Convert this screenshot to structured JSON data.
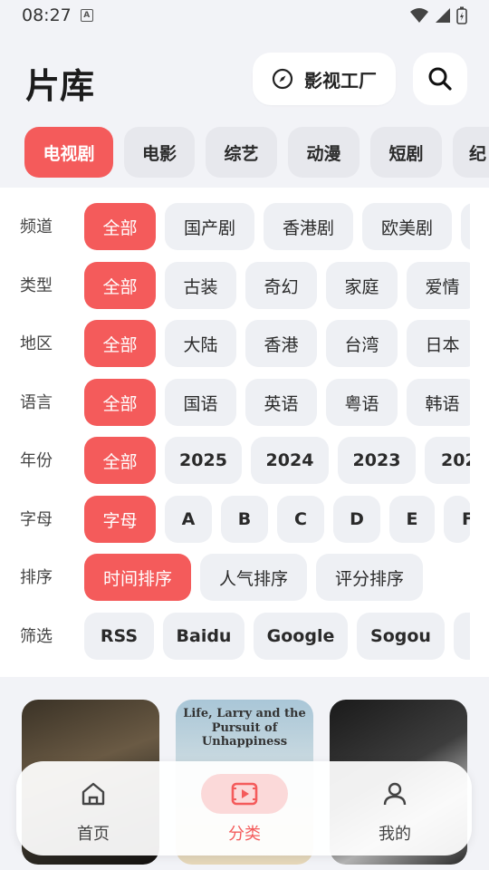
{
  "status_bar": {
    "time": "08:27",
    "notification_icon": "a-icon"
  },
  "header": {
    "title": "片库",
    "studio_label": "影视工厂",
    "studio_icon": "compass-icon",
    "search_icon": "search-icon"
  },
  "categories": [
    {
      "label": "电视剧",
      "active": true
    },
    {
      "label": "电影",
      "active": false
    },
    {
      "label": "综艺",
      "active": false
    },
    {
      "label": "动漫",
      "active": false
    },
    {
      "label": "短剧",
      "active": false
    },
    {
      "label": "纪",
      "active": false
    }
  ],
  "filters": [
    {
      "label": "频道",
      "options": [
        "全部",
        "国产剧",
        "香港剧",
        "欧美剧",
        ""
      ],
      "selected": 0
    },
    {
      "label": "类型",
      "options": [
        "全部",
        "古装",
        "奇幻",
        "家庭",
        "爱情"
      ],
      "selected": 0
    },
    {
      "label": "地区",
      "options": [
        "全部",
        "大陆",
        "香港",
        "台湾",
        "日本"
      ],
      "selected": 0
    },
    {
      "label": "语言",
      "options": [
        "全部",
        "国语",
        "英语",
        "粤语",
        "韩语"
      ],
      "selected": 0
    },
    {
      "label": "年份",
      "options": [
        "全部",
        "2025",
        "2024",
        "2023",
        "202"
      ],
      "selected": 0
    },
    {
      "label": "字母",
      "options": [
        "字母",
        "A",
        "B",
        "C",
        "D",
        "E",
        "F"
      ],
      "selected": 0
    },
    {
      "label": "排序",
      "options": [
        "时间排序",
        "人气排序",
        "评分排序"
      ],
      "selected": 0
    },
    {
      "label": "筛选",
      "options": [
        "RSS",
        "Baidu",
        "Google",
        "Sogou",
        ""
      ],
      "selected": -1
    }
  ],
  "posters": [
    {
      "text": ""
    },
    {
      "text": "Life, Larry and the Pursuit of Unhappiness"
    },
    {
      "text": ""
    }
  ],
  "bottom_nav": [
    {
      "label": "首页",
      "icon": "home-icon",
      "active": false
    },
    {
      "label": "分类",
      "icon": "play-box-icon",
      "active": true
    },
    {
      "label": "我的",
      "icon": "person-icon",
      "active": false
    }
  ],
  "colors": {
    "accent": "#f45b5b",
    "chip_bg": "#eef0f4",
    "page_bg": "#f2f3f7"
  }
}
